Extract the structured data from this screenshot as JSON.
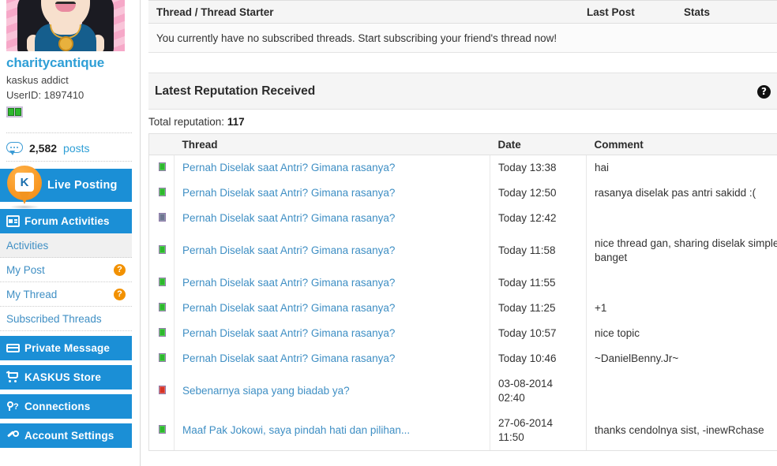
{
  "profile": {
    "avatar_name": "user-avatar",
    "username": "charitycantique",
    "usertitle": "kaskus addict",
    "userid_label": "UserID: 1897410",
    "reputation_bars": 2,
    "posts_count": "2,582",
    "posts_label": "posts"
  },
  "sidebar": {
    "live_posting": {
      "label": "Live Posting",
      "icon": "kaskus-logo-icon",
      "badge_letter": "K"
    },
    "sections": [
      {
        "label": "Forum Activities",
        "icon": "forum-icon"
      },
      {
        "label": "Private Message",
        "icon": "envelope-icon"
      },
      {
        "label": "KASKUS Store",
        "icon": "cart-icon"
      },
      {
        "label": "Connections",
        "icon": "connections-icon"
      },
      {
        "label": "Account Settings",
        "icon": "gear-icon"
      }
    ],
    "sub_items": [
      {
        "label": "Activities",
        "badge": "",
        "active": true
      },
      {
        "label": "My Post",
        "badge": "?",
        "active": false
      },
      {
        "label": "My Thread",
        "badge": "?",
        "active": false
      },
      {
        "label": "Subscribed Threads",
        "badge": "",
        "active": false
      }
    ]
  },
  "subscribed_panel": {
    "columns": {
      "thread": "Thread / Thread Starter",
      "last_post": "Last Post",
      "stats": "Stats"
    },
    "empty_message": "You currently have no subscribed threads. Start subscribing your friend's thread now!"
  },
  "reputation": {
    "title": "Latest Reputation Received",
    "help_icon": "help-icon",
    "help_glyph": "?",
    "total_label": "Total reputation:",
    "total_value": "117",
    "columns": {
      "thread": "Thread",
      "date": "Date",
      "comment": "Comment"
    },
    "rows": [
      {
        "status": "green",
        "thread": "Pernah Diselak saat Antri? Gimana rasanya?",
        "date": "Today 13:38",
        "comment": "hai"
      },
      {
        "status": "green",
        "thread": "Pernah Diselak saat Antri? Gimana rasanya?",
        "date": "Today 12:50",
        "comment": "rasanya diselak pas antri sakidd :("
      },
      {
        "status": "gray",
        "thread": "Pernah Diselak saat Antri? Gimana rasanya?",
        "date": "Today 12:42",
        "comment": ""
      },
      {
        "status": "green",
        "thread": "Pernah Diselak saat Antri? Gimana rasanya?",
        "date": "Today 11:58",
        "comment": "nice thread gan, sharing diselak simple tapi menarik perhatian ane banget"
      },
      {
        "status": "green",
        "thread": "Pernah Diselak saat Antri? Gimana rasanya?",
        "date": "Today 11:55",
        "comment": ""
      },
      {
        "status": "green",
        "thread": "Pernah Diselak saat Antri? Gimana rasanya?",
        "date": "Today 11:25",
        "comment": "+1"
      },
      {
        "status": "green",
        "thread": "Pernah Diselak saat Antri? Gimana rasanya?",
        "date": "Today 10:57",
        "comment": "nice topic"
      },
      {
        "status": "green",
        "thread": "Pernah Diselak saat Antri? Gimana rasanya?",
        "date": "Today 10:46",
        "comment": "~DanielBenny.Jr~"
      },
      {
        "status": "red",
        "thread": "Sebenarnya siapa yang biadab ya?",
        "date": "03-08-2014 02:40",
        "comment": ""
      },
      {
        "status": "green",
        "thread": "Maaf Pak Jokowi, saya pindah hati dan pilihan...",
        "date": "27-06-2014 11:50",
        "comment": "thanks cendolnya sist, -inewRchase"
      }
    ]
  },
  "colors": {
    "brand_blue": "#1b8fd6",
    "link_blue": "#3f8fc4",
    "orange": "#f29100",
    "green": "#2eb82e",
    "red": "#d63427",
    "gray_status": "#6e7690"
  }
}
